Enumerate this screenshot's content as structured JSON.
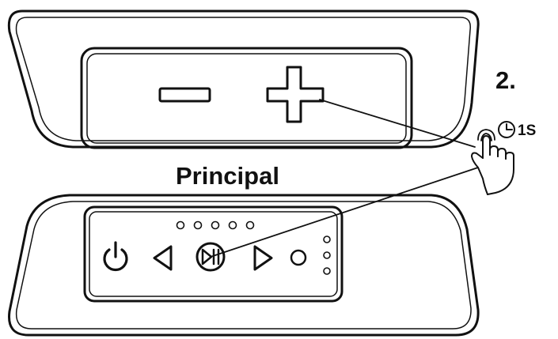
{
  "diagram": {
    "step_label": "2.",
    "unit_label": "Principal",
    "hold_time_label": "1S",
    "icons": {
      "minus": "minus-icon",
      "plus": "plus-icon",
      "power": "power-icon",
      "previous": "previous-triangle-icon",
      "play_pause": "play-pause-icon",
      "next": "next-triangle-icon",
      "mode": "mode-circle-icon",
      "timer": "timer-clock-icon",
      "hand": "pressing-hand-icon"
    },
    "top_indicator_leds": 5,
    "side_indicator_leds": 3,
    "colors": {
      "line": "#111111",
      "background": "#ffffff"
    }
  }
}
